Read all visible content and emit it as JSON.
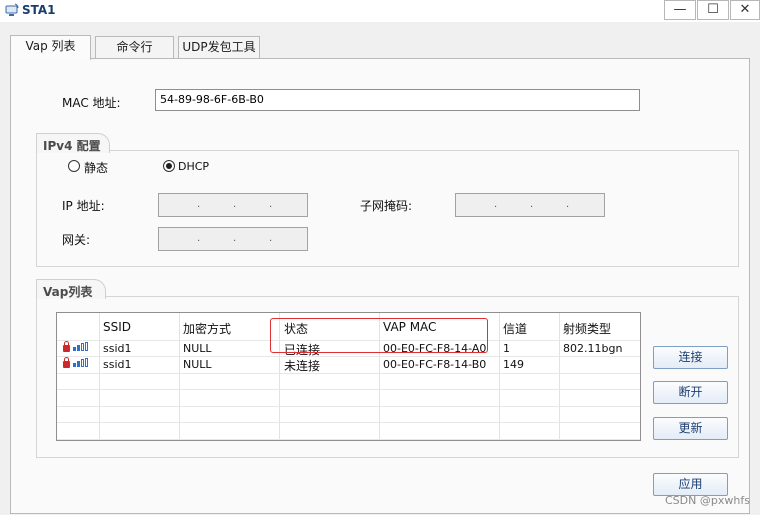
{
  "window": {
    "title": "STA1",
    "min": "—",
    "max": "☐",
    "close": "✕"
  },
  "tabs": [
    {
      "label": "Vap 列表",
      "active": true
    },
    {
      "label": "命令行",
      "active": false
    },
    {
      "label": "UDP发包工具",
      "active": false
    }
  ],
  "mac": {
    "label": "MAC 地址:",
    "value": "54-89-98-6F-6B-B0"
  },
  "ipv4": {
    "legend": "IPv4 配置",
    "static_label": "静态",
    "dhcp_label": "DHCP",
    "selected": "DHCP",
    "ip_label": "IP 地址:",
    "mask_label": "子网掩码:",
    "gateway_label": "网关:",
    "dots": "."
  },
  "vap": {
    "legend": "Vap列表",
    "columns": [
      "SSID",
      "加密方式",
      "状态",
      "VAP MAC",
      "信道",
      "射频类型"
    ],
    "rows": [
      {
        "ssid": "ssid1",
        "encryption": "NULL",
        "status": "已连接",
        "vap_mac": "00-E0-FC-F8-14-A0",
        "channel": "1",
        "radio": "802.11bgn"
      },
      {
        "ssid": "ssid1",
        "encryption": "NULL",
        "status": "未连接",
        "vap_mac": "00-E0-FC-F8-14-B0",
        "channel": "149",
        "radio": ""
      }
    ],
    "buttons": {
      "connect": "连接",
      "disconnect": "断开",
      "refresh": "更新"
    }
  },
  "apply_label": "应用",
  "watermark": "CSDN @pxwhfs",
  "colors": {
    "highlight": "#e03030",
    "signal": "#2f6fd0",
    "lock": "#cc2a2a",
    "button_text": "#1d3f73"
  }
}
